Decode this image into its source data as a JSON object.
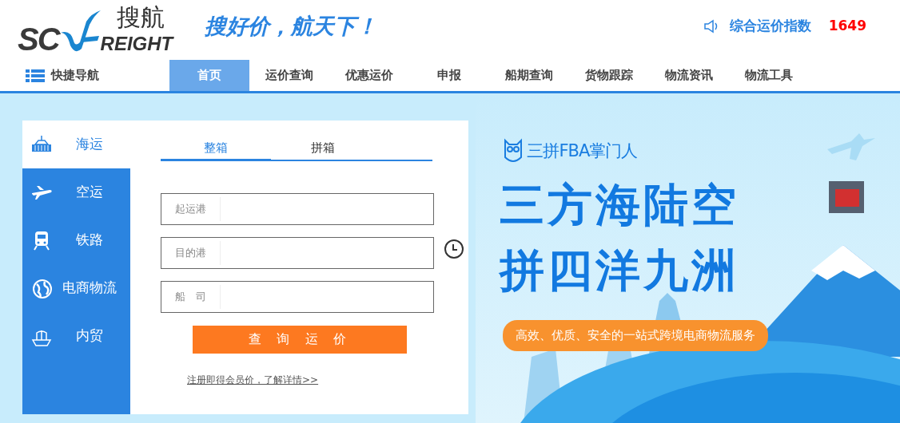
{
  "header": {
    "logo": {
      "letters": "SC",
      "tail": "REIGHT",
      "chinese": "搜航"
    },
    "slogan": "搜好价，航天下！",
    "index": {
      "label": "综合运价指数",
      "value": "1649"
    }
  },
  "nav": {
    "quick_nav": "快捷导航",
    "items": [
      {
        "label": "首页",
        "selected": true
      },
      {
        "label": "运价查询",
        "selected": false
      },
      {
        "label": "优惠运价",
        "selected": false
      },
      {
        "label": "申报",
        "selected": false
      },
      {
        "label": "船期查询",
        "selected": false
      },
      {
        "label": "货物跟踪",
        "selected": false
      },
      {
        "label": "物流资讯",
        "selected": false
      },
      {
        "label": "物流工具",
        "selected": false
      }
    ]
  },
  "modes": [
    {
      "label": "海运",
      "selected": true
    },
    {
      "label": "空运",
      "selected": false
    },
    {
      "label": "铁路",
      "selected": false
    },
    {
      "label": "电商物流",
      "selected": false
    },
    {
      "label": "内贸",
      "selected": false
    }
  ],
  "search": {
    "tabs": [
      {
        "label": "整箱",
        "selected": true
      },
      {
        "label": "拼箱",
        "selected": false
      }
    ],
    "fields": [
      {
        "label": "起运港"
      },
      {
        "label": "目的港"
      },
      {
        "label": "船　司"
      }
    ],
    "submit": "查询运价",
    "register_link": "注册即得会员价，了解详情>>"
  },
  "banner": {
    "kind": "picture",
    "brand": "三拼FBA掌门人",
    "headline": [
      "三方海陆空",
      "拼四洋九洲"
    ],
    "tagline": "高效、优质、安全的一站式跨境电商物流服务"
  }
}
